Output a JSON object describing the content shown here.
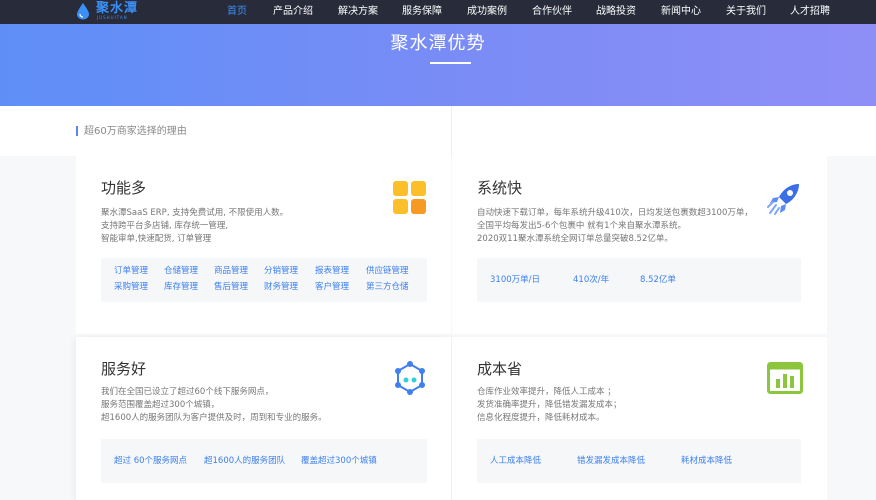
{
  "logo": {
    "name": "聚水潭",
    "sub": "JUSHUITAN"
  },
  "nav": [
    {
      "label": "首页",
      "active": true
    },
    {
      "label": "产品介绍"
    },
    {
      "label": "解决方案"
    },
    {
      "label": "服务保障"
    },
    {
      "label": "成功案例"
    },
    {
      "label": "合作伙伴"
    },
    {
      "label": "战略投资"
    },
    {
      "label": "新闻中心"
    },
    {
      "label": "关于我们"
    },
    {
      "label": "人才招聘"
    }
  ],
  "banner": {
    "title": "聚水潭优势"
  },
  "section": {
    "subtitle": "超60万商家选择的理由"
  },
  "cards": {
    "features": {
      "title": "功能多",
      "desc": [
        "聚水潭SaaS ERP, 支持免费试用, 不限使用人数。",
        "支持跨平台多店铺, 库存统一管理,",
        "智能审单,快速配货, 订单管理"
      ],
      "tags": [
        "订单管理",
        "仓储管理",
        "商品管理",
        "分销管理",
        "报表管理",
        "供应链管理",
        "采购管理",
        "库存管理",
        "售后管理",
        "财务管理",
        "客户管理",
        "第三方仓储"
      ]
    },
    "speed": {
      "title": "系统快",
      "desc": [
        "自动快速下载订单，每年系统升级410次，日均发送包裹数超3100万单，",
        "全国平均每发出5-6个包裹中 就有1个来自聚水潭系统。",
        "2020双11聚水潭系统全网订单总量突破8.52亿单。"
      ],
      "tags": [
        "3100万单/日",
        "410次/年",
        "8.52亿单"
      ]
    },
    "service": {
      "title": "服务好",
      "desc": [
        "我们在全国已设立了超过60个线下服务网点，",
        "服务范围覆盖超过300个城镇，",
        "超1600人的服务团队为客户提供及时，周到和专业的服务。"
      ],
      "tags": [
        "超过 60个服务网点",
        "超1600人的服务团队",
        "覆盖超过300个城镇"
      ]
    },
    "cost": {
      "title": "成本省",
      "desc": [
        "仓库作业效率提升，降低人工成本 ；",
        "发货准确率提升，降低错发漏发成本；",
        "信息化程度提升，降低耗材成本。"
      ],
      "tags": [
        "人工成本降低",
        "错发漏发成本降低",
        "耗材成本降低"
      ]
    }
  },
  "colors": {
    "accent": "#3b8ff6",
    "nav_bg": "#272b3a",
    "tag_text": "#3b7ff0"
  }
}
